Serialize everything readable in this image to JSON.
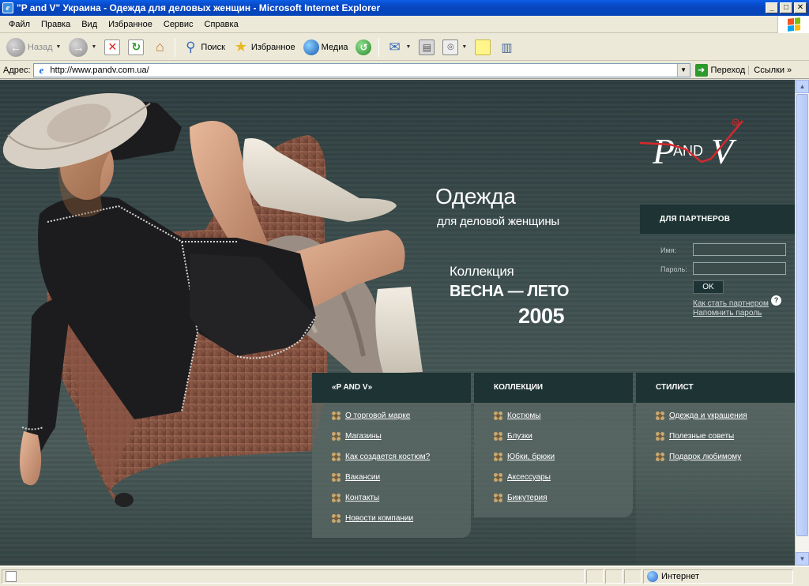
{
  "window": {
    "title": "\"P and V\" Украина - Одежда для деловых женщин - Microsoft Internet Explorer",
    "minimize": "_",
    "maximize": "□",
    "close": "✕"
  },
  "menu": {
    "items": [
      {
        "label": "Файл"
      },
      {
        "label": "Правка"
      },
      {
        "label": "Вид"
      },
      {
        "label": "Избранное"
      },
      {
        "label": "Сервис"
      },
      {
        "label": "Справка"
      }
    ]
  },
  "toolbar": {
    "back_label": "Назад",
    "search_label": "Поиск",
    "favorites_label": "Избранное",
    "media_label": "Медиа"
  },
  "address": {
    "label": "Адрес:",
    "url": "http://www.pandv.com.ua/",
    "go_label": "Переход",
    "links_label": "Ссылки"
  },
  "page": {
    "logo_text": "PandV",
    "headline": "Одежда",
    "subheadline": "для деловой женщины",
    "collection_label": "Коллекция",
    "season": "ВЕСНА — ЛЕТО",
    "year": "2005",
    "partners": {
      "title": "ДЛЯ ПАРТНЕРОВ",
      "name_label": "Имя:",
      "password_label": "Пароль:",
      "ok_label": "OK",
      "become_partner_link": "Как стать партнером",
      "remind_password_link": "Напомнить пароль"
    },
    "nav": [
      {
        "title": "«P AND V»",
        "items": [
          "О торговой марке",
          "Магазины",
          "Как создается костюм?",
          "Вакансии",
          "Контакты",
          "Новости компании"
        ]
      },
      {
        "title": "КОЛЛЕКЦИИ",
        "items": [
          "Костюмы",
          "Блузки",
          "Юбки, брюки",
          "Аксессуары",
          "Бижутерия"
        ]
      },
      {
        "title": "СТИЛИСТ",
        "items": [
          "Одежда и украшения",
          "Полезные советы",
          "Подарок любимому"
        ]
      }
    ]
  },
  "status": {
    "zone": "Интернет"
  },
  "colors": {
    "panel_dark": "#1e3333",
    "page_bg": "#3d4e4e",
    "accent_gold": "#c9a76e",
    "logo_red": "#d8282c"
  }
}
